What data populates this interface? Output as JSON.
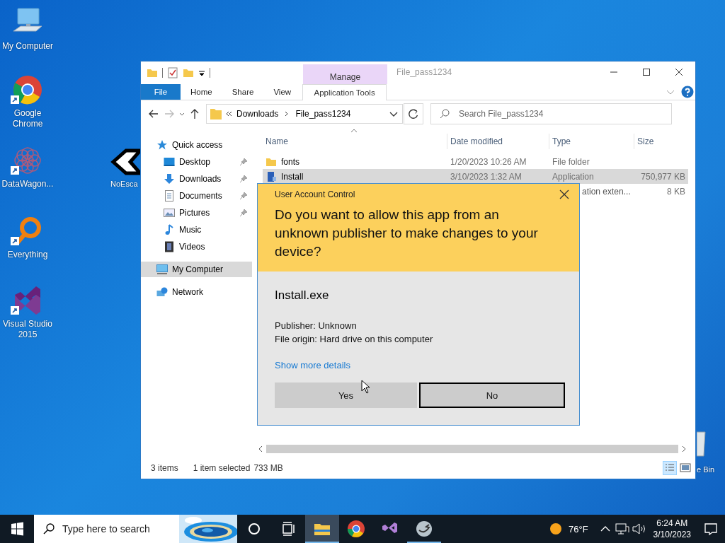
{
  "desktop_icons": [
    {
      "label": "My Computer",
      "kind": "computer",
      "shortcut": false
    },
    {
      "label": "Google Chrome",
      "kind": "chrome",
      "shortcut": true
    },
    {
      "label": "DataWagon...",
      "kind": "datawagon",
      "shortcut": true
    },
    {
      "label": "Everything",
      "kind": "everything",
      "shortcut": true
    },
    {
      "label": "Visual Studio 2015",
      "kind": "vstudio",
      "shortcut": true
    },
    {
      "label": "NoEsca",
      "kind": "noescape",
      "shortcut": false
    },
    {
      "label": "e Bin",
      "kind": "recycle",
      "shortcut": false
    }
  ],
  "explorer": {
    "title": "File_pass1234",
    "context_tab": "Manage",
    "ribbon_tabs": [
      {
        "label": "File",
        "kind": "file",
        "selected": false
      },
      {
        "label": "Home",
        "kind": "plain",
        "selected": false
      },
      {
        "label": "Share",
        "kind": "plain",
        "selected": false
      },
      {
        "label": "View",
        "kind": "plain",
        "selected": false
      },
      {
        "label": "Application Tools",
        "kind": "context",
        "selected": false
      }
    ],
    "breadcrumb": [
      "Downloads",
      "File_pass1234"
    ],
    "search": {
      "placeholder": "Search File_pass1234"
    },
    "nav": [
      {
        "label": "Quick access",
        "kind": "star",
        "selected": false,
        "children": [
          {
            "label": "Desktop",
            "kind": "desktop",
            "pinned": true,
            "selected": false
          },
          {
            "label": "Downloads",
            "kind": "download",
            "pinned": true,
            "selected": false
          },
          {
            "label": "Documents",
            "kind": "document",
            "pinned": true,
            "selected": false
          },
          {
            "label": "Pictures",
            "kind": "picture",
            "pinned": true,
            "selected": false
          },
          {
            "label": "Music",
            "kind": "music",
            "pinned": false,
            "selected": false
          },
          {
            "label": "Videos",
            "kind": "video",
            "pinned": false,
            "selected": false
          }
        ]
      },
      {
        "label": "My Computer",
        "kind": "computer",
        "selected": true
      },
      {
        "label": "Network",
        "kind": "network",
        "selected": false
      }
    ],
    "columns": [
      "Name",
      "Date modified",
      "Type",
      "Size"
    ],
    "rows": [
      {
        "kind": "folder",
        "name": "fonts",
        "date": "1/20/2023 10:26 AM",
        "type": "File folder",
        "selected": false
      },
      {
        "kind": "app",
        "name": "Install",
        "date": "3/10/2023 1:32 AM",
        "type": "Application",
        "size": "750,977 KB",
        "selected": true
      },
      {
        "kind": "hidden",
        "type": "ation exten...",
        "size": "8 KB",
        "selected": false
      }
    ],
    "status": [
      "3 items",
      "1 item selected",
      "733 MB"
    ]
  },
  "uac": {
    "title": "User Account Control",
    "question": "Do you want to allow this app from an unknown publisher to make changes to your device?",
    "program": "Install.exe",
    "publisher": "Publisher: Unknown",
    "origin": "File origin: Hard drive on this computer",
    "link": "Show more details",
    "buttons": [
      {
        "label": "Yes",
        "focused": false
      },
      {
        "label": "No",
        "focused": true
      }
    ]
  },
  "taskbar": {
    "search": {
      "placeholder": "Type here to search"
    },
    "apps": [
      {
        "kind": "explorer",
        "running": true,
        "active": true
      },
      {
        "kind": "chrome",
        "running": false,
        "active": false
      },
      {
        "kind": "vstudio",
        "running": false,
        "active": false
      },
      {
        "kind": "noescape",
        "running": true,
        "active": false
      }
    ],
    "weather": "76°F",
    "time": "6:24 AM",
    "date": "3/10/2023"
  }
}
